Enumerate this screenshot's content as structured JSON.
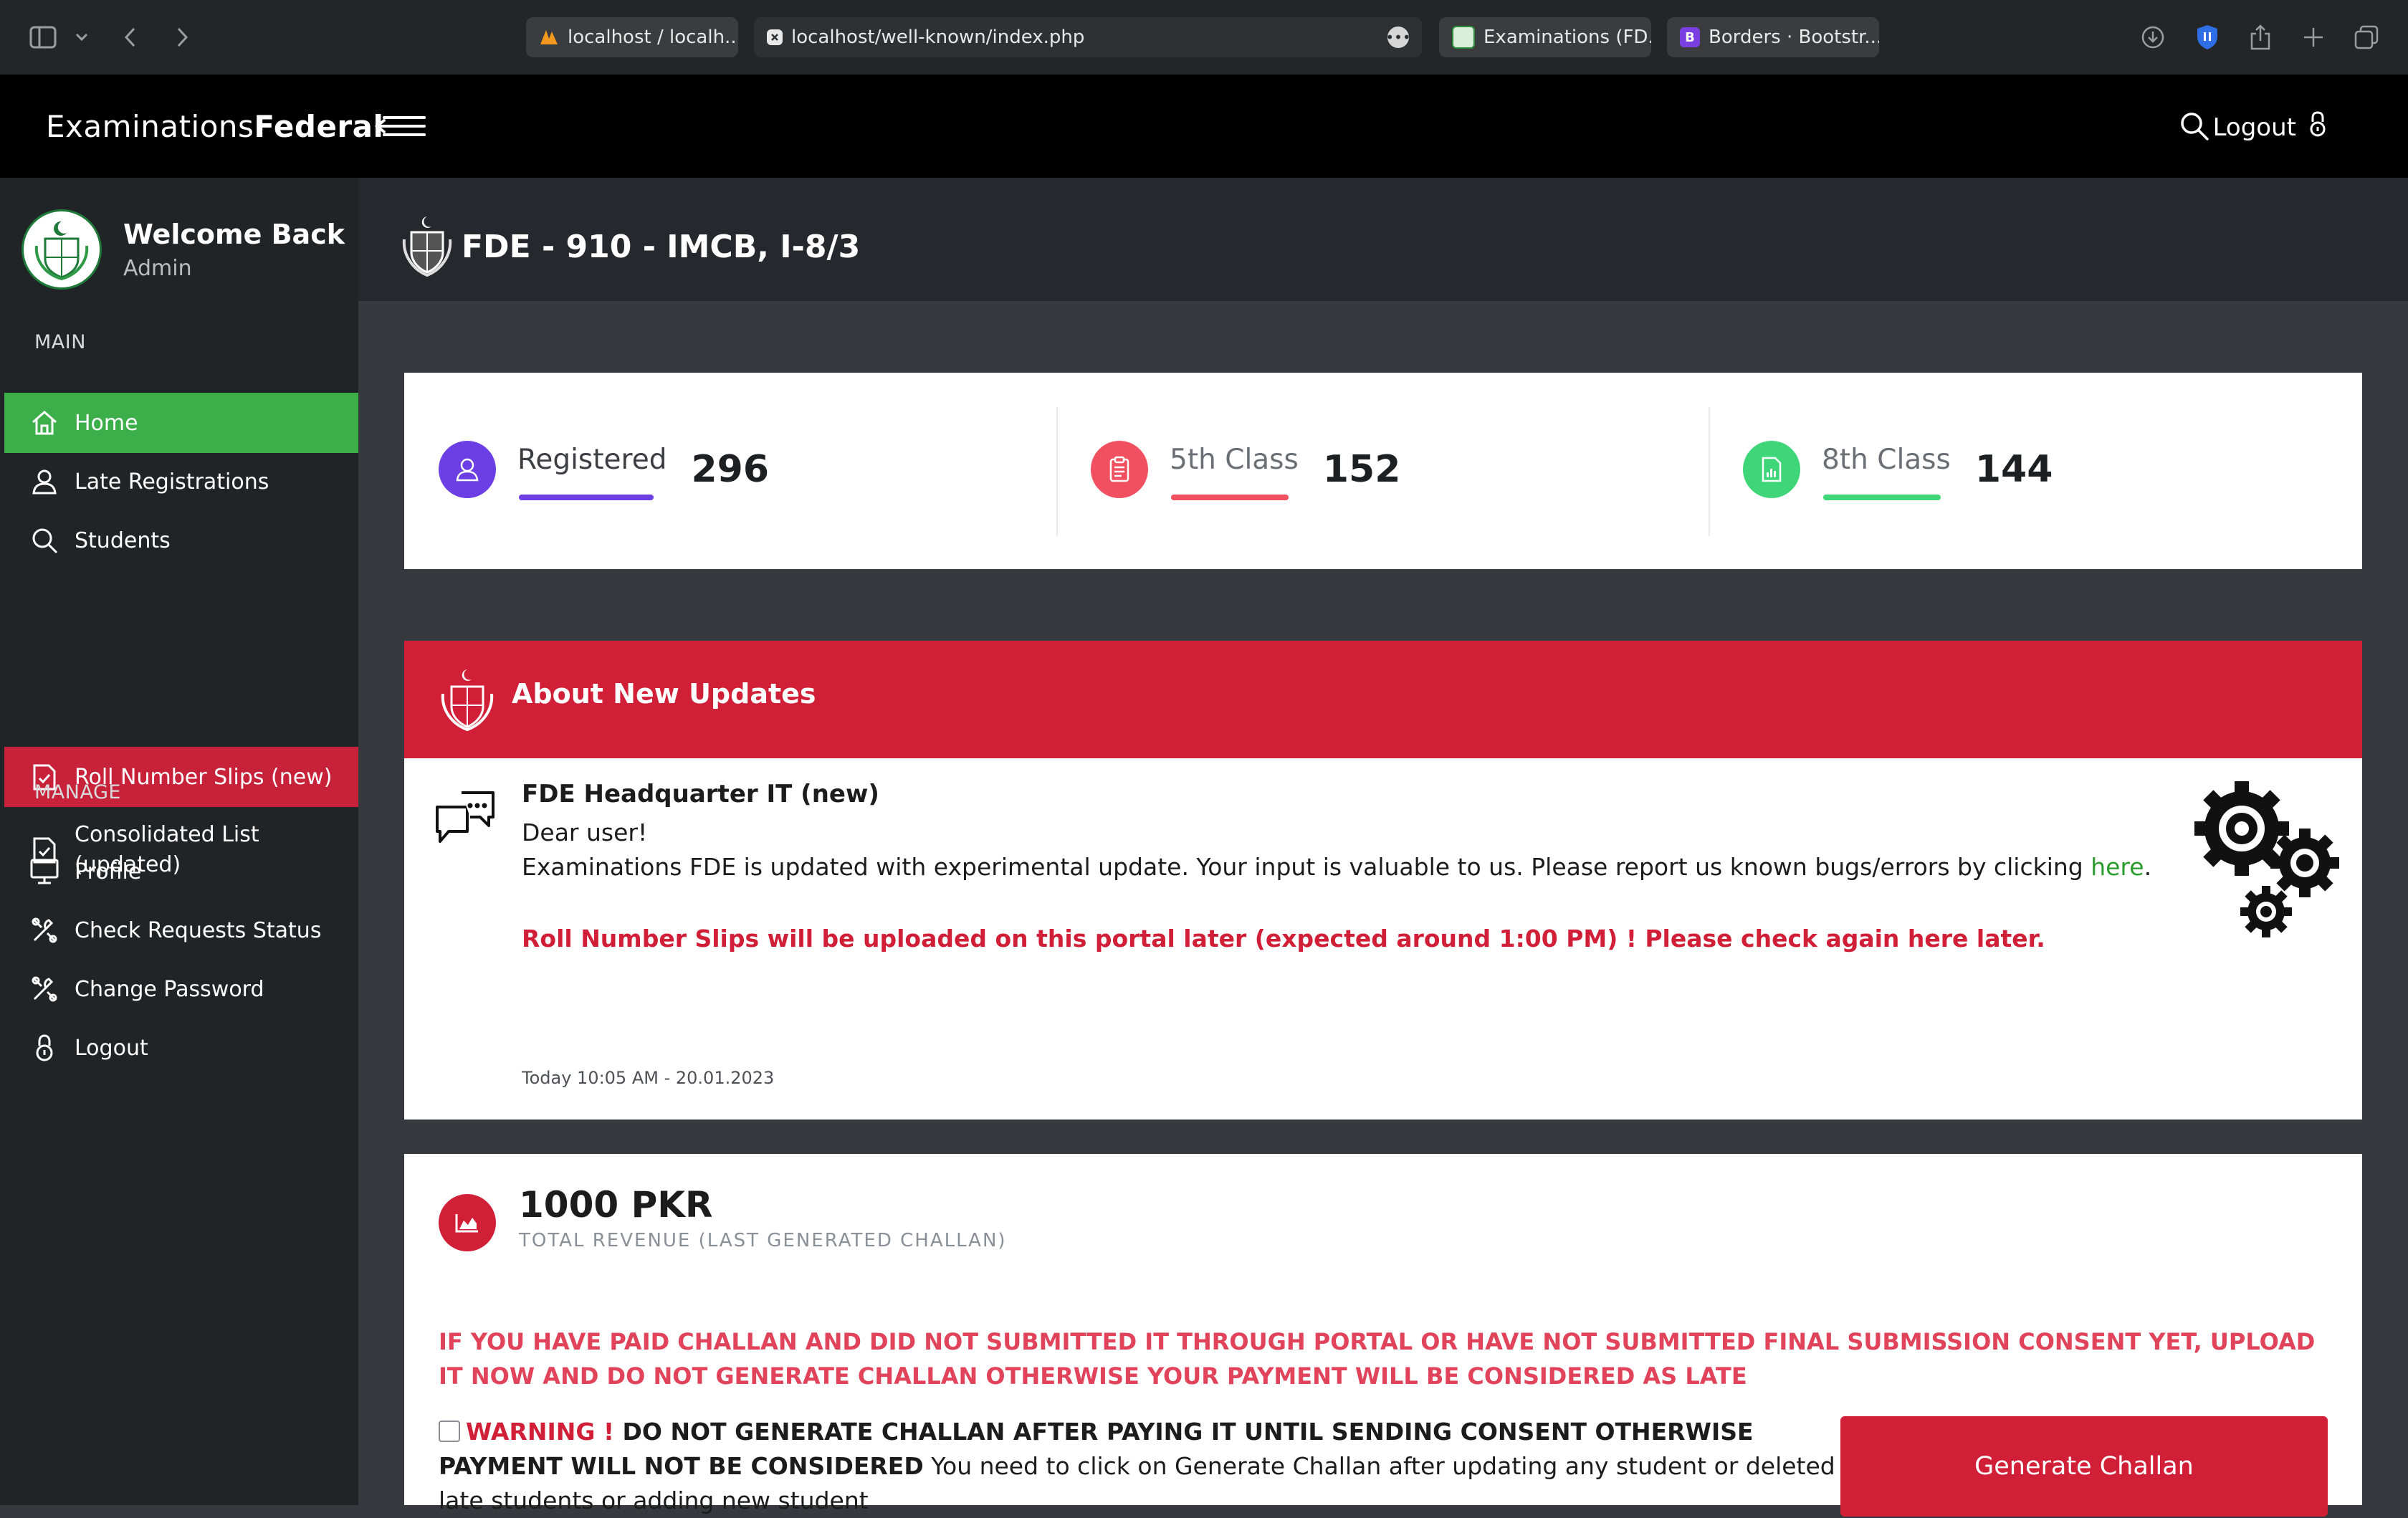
{
  "browser": {
    "tabs": [
      {
        "label": "localhost / localh..."
      },
      {
        "label": "localhost/well-known/index.php"
      },
      {
        "label": "Examinations (FD..."
      },
      {
        "label": "Borders · Bootstr..."
      }
    ],
    "bootstrap_badge": "B"
  },
  "header": {
    "brand_light": "Examinations",
    "brand_bold": "Federal",
    "logout_label": "Logout"
  },
  "sidebar": {
    "welcome": "Welcome Back",
    "role": "Admin",
    "section_main": "MAIN",
    "section_manage": "MANAGE",
    "main_items": [
      {
        "label": "Home",
        "icon": "home-icon"
      },
      {
        "label": "Late Registrations",
        "icon": "user-icon"
      },
      {
        "label": "Students",
        "icon": "search-icon"
      },
      {
        "label": "Roll Number Slips (new)",
        "icon": "checklist-icon"
      },
      {
        "label": "Consolidated List (updated)",
        "icon": "checklist-icon"
      }
    ],
    "manage_items": [
      {
        "label": "Profile",
        "icon": "monitor-icon"
      },
      {
        "label": "Check Requests Status",
        "icon": "tools-icon"
      },
      {
        "label": "Change Password",
        "icon": "tools-icon"
      },
      {
        "label": "Logout",
        "icon": "lock-icon"
      }
    ]
  },
  "page": {
    "title": "FDE - 910 - IMCB, I-8/3"
  },
  "stats": [
    {
      "label": "Registered",
      "value": "296",
      "color": "#6c3fe4"
    },
    {
      "label": "5th Class",
      "value": "152",
      "color": "#f0505f"
    },
    {
      "label": "8th Class",
      "value": "144",
      "color": "#3fd67a"
    }
  ],
  "updates": {
    "heading": "About New Updates",
    "author": "FDE Headquarter IT (new)",
    "greeting": "Dear user!",
    "message": "Examinations FDE is updated with experimental update. Your input is valuable to us. Please report us known bugs/errors by clicking ",
    "link_label": "here",
    "message_end": ".",
    "warning": "Roll Number Slips will be uploaded on this portal later (expected around 1:00 PM) ! Please check again here later.",
    "timestamp": "Today 10:05 AM - 20.01.2023"
  },
  "revenue": {
    "amount": "1000 PKR",
    "subtitle": "TOTAL REVENUE (LAST GENERATED CHALLAN)",
    "alert": "IF YOU HAVE PAID CHALLAN AND DID NOT SUBMITTED IT THROUGH PORTAL OR HAVE NOT SUBMITTED FINAL SUBMISSION CONSENT YET, UPLOAD IT NOW AND DO NOT GENERATE CHALLAN OTHERWISE YOUR PAYMENT WILL BE CONSIDERED AS LATE",
    "warning_label": "WARNING !",
    "warning_bold": " DO NOT GENERATE CHALLAN AFTER PAYING IT UNTIL SENDING CONSENT OTHERWISE PAYMENT WILL NOT BE CONSIDERED",
    "warning_rest": " You need to click on Generate Challan after updating any student or deleted late students or adding new student",
    "button_label": "Generate Challan"
  },
  "colors": {
    "active_nav": "#3cae4a",
    "red_accent": "#d11f37"
  }
}
